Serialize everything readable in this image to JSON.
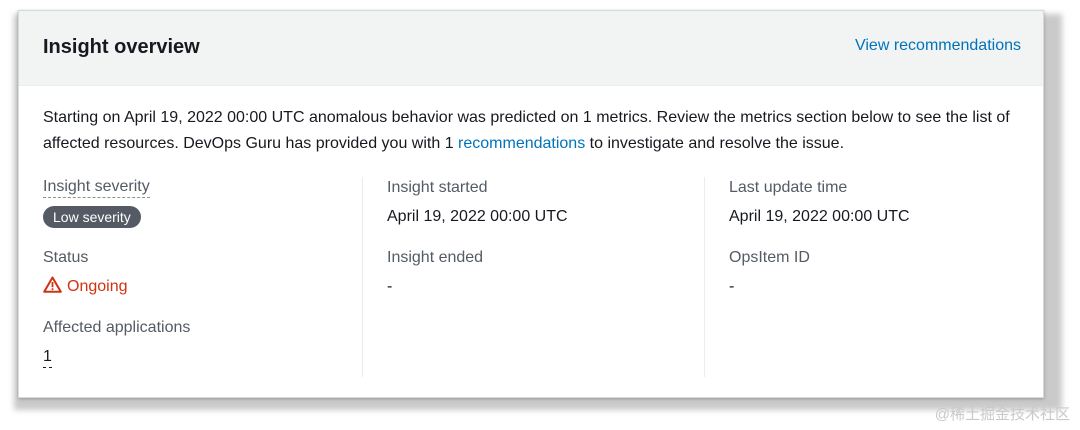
{
  "header": {
    "title": "Insight overview",
    "view_recommendations": "View recommendations"
  },
  "description": {
    "part1": "Starting on April 19, 2022 00:00 UTC anomalous behavior was predicted on 1 metrics. Review the metrics section below to see the list of affected resources. DevOps Guru has provided you with 1 ",
    "link": "recommendations",
    "part2": " to investigate and resolve the issue."
  },
  "column1": {
    "severity_label": "Insight severity",
    "severity_badge": "Low severity",
    "status_label": "Status",
    "status_value": "Ongoing",
    "affected_label": "Affected applications",
    "affected_value": "1"
  },
  "column2": {
    "started_label": "Insight started",
    "started_value": "April 19, 2022 00:00 UTC",
    "ended_label": "Insight ended",
    "ended_value": "-"
  },
  "column3": {
    "update_label": "Last update time",
    "update_value": "April 19, 2022 00:00 UTC",
    "opsitem_label": "OpsItem ID",
    "opsitem_value": "-"
  },
  "colors": {
    "link": "#0073bb",
    "status_warning": "#d13212",
    "badge_bg": "#545b64"
  },
  "icons": {
    "status": "warning-icon"
  },
  "watermark": "@稀土掘金技术社区"
}
